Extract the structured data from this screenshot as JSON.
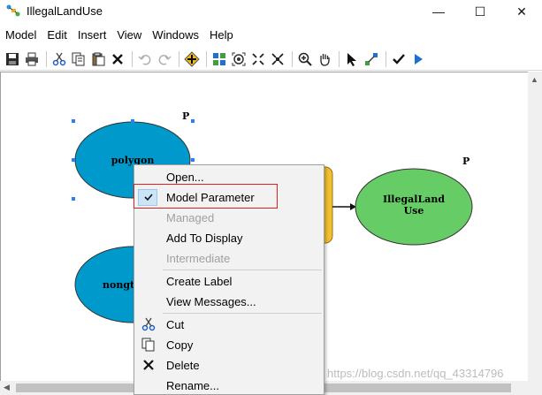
{
  "window": {
    "title": "IllegalLandUse",
    "minimize_glyph": "—",
    "maximize_glyph": "☐",
    "close_glyph": "✕"
  },
  "menubar": {
    "items": [
      "Model",
      "Edit",
      "Insert",
      "View",
      "Windows",
      "Help"
    ]
  },
  "toolbar": {
    "icons": [
      "save-icon",
      "print-icon",
      "cut-icon",
      "copy-icon",
      "paste-icon",
      "delete-icon",
      "undo-icon",
      "redo-icon",
      "add-data-icon",
      "auto-layout-icon",
      "full-extent-icon",
      "fixed-zoom-in-icon",
      "fixed-zoom-out-icon",
      "zoom-in-icon",
      "pan-icon",
      "select-icon",
      "connect-icon",
      "validate-icon",
      "run-icon"
    ]
  },
  "diagram": {
    "nodes": [
      {
        "name": "polygon",
        "label": "polygon",
        "parameter_marker": "P"
      },
      {
        "name": "nongtian",
        "label": "nongt"
      },
      {
        "name": "illegal-land-use",
        "label_line1": "IllegalLand",
        "label_line2": "Use",
        "parameter_marker": "P"
      }
    ]
  },
  "context_menu": {
    "items": [
      {
        "label": "Open...",
        "enabled": true
      },
      {
        "label": "Model Parameter",
        "enabled": true,
        "checked": true
      },
      {
        "label": "Managed",
        "enabled": false
      },
      {
        "label": "Add To Display",
        "enabled": true
      },
      {
        "label": "Intermediate",
        "enabled": false
      },
      {
        "label": "Create Label",
        "enabled": true
      },
      {
        "label": "View Messages...",
        "enabled": true
      },
      {
        "label": "Cut",
        "enabled": true,
        "icon": "cut-icon"
      },
      {
        "label": "Copy",
        "enabled": true,
        "icon": "copy-icon"
      },
      {
        "label": "Delete",
        "enabled": true,
        "icon": "delete-icon"
      },
      {
        "label": "Rename...",
        "enabled": true
      }
    ]
  },
  "watermark": "https://blog.csdn.net/qq_43314796",
  "colors": {
    "blue_node": "#0099cc",
    "green_node": "#66cc66",
    "tool_node": "#f0c030",
    "highlight_border": "#e02020"
  }
}
